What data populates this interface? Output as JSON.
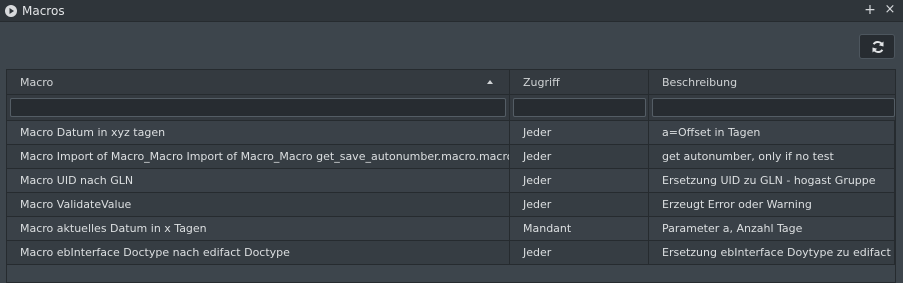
{
  "window": {
    "title": "Macros",
    "add_label": "+",
    "close_label": "×"
  },
  "toolbar": {
    "refresh_icon": "refresh-icon"
  },
  "table": {
    "columns": [
      "Macro",
      "Zugriff",
      "Beschreibung"
    ],
    "sort_column": "Macro",
    "sort_direction": "ascending",
    "filters": [
      "",
      "",
      ""
    ],
    "rows": [
      [
        "Macro Datum in xyz tagen",
        "Jeder",
        "a=Offset in Tagen"
      ],
      [
        "Macro Import of Macro_Macro Import of Macro_Macro get_save_autonumber.macro.macro",
        "Jeder",
        "get autonumber, only if no test"
      ],
      [
        "Macro UID nach GLN",
        "Jeder",
        "Ersetzung UID zu GLN - hogast Gruppe"
      ],
      [
        "Macro ValidateValue",
        "Jeder",
        "Erzeugt Error oder Warning"
      ],
      [
        "Macro aktuelles Datum in x Tagen",
        "Mandant",
        "Parameter a, Anzahl Tage"
      ],
      [
        "Macro ebInterface Doctype nach edifact Doctype",
        "Jeder",
        "Ersetzung ebInterface Doytype zu edifact"
      ]
    ]
  },
  "colors": {
    "background": "#3d454c",
    "titlebar": "#2f353a",
    "header": "#343a40",
    "border": "#262b2f"
  }
}
